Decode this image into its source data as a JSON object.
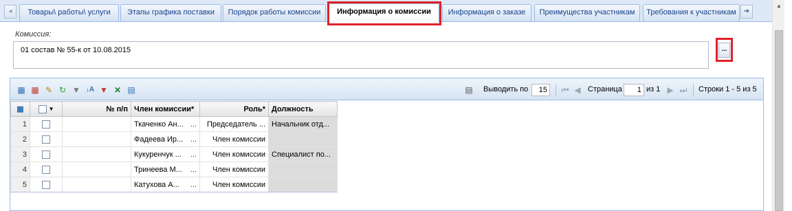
{
  "tabs": {
    "scroll_left": "◂",
    "scroll_right": "➔",
    "items": [
      {
        "label": "Товары\\ работы\\ услуги"
      },
      {
        "label": "Этапы графика поставки"
      },
      {
        "label": "Порядок работы комиссии"
      },
      {
        "label": "Информация о комиссии"
      },
      {
        "label": "Информация о заказе"
      },
      {
        "label": "Преимущества участникам"
      },
      {
        "label": "Требования к участникам"
      }
    ]
  },
  "commission": {
    "label": "Комиссия:",
    "value": "01 состав № 55-к от 10.08.2015",
    "browse_label": "..."
  },
  "toolbar": {
    "page_size_label": "Выводить по",
    "page_size": "15",
    "page_label": "Страница",
    "page": "1",
    "page_of": "из 1",
    "rows_info": "Строки 1 - 5 из 5"
  },
  "grid": {
    "columns": [
      "№ п/п",
      "Член комиссии*",
      "Роль*",
      "Должность"
    ],
    "rows": [
      {
        "n": "1",
        "member": "Ткаченко Ан...",
        "role": "Председатель ...",
        "position": "Начальник отд..."
      },
      {
        "n": "2",
        "member": "Фадеева Ир...",
        "role": "Член комиссии",
        "position": ""
      },
      {
        "n": "3",
        "member": "Кукуренчук ...",
        "role": "Член комиссии",
        "position": "Специалист по..."
      },
      {
        "n": "4",
        "member": "Тринеева М...",
        "role": "Член комиссии",
        "position": ""
      },
      {
        "n": "5",
        "member": "Катухова А...",
        "role": "Член комиссии",
        "position": ""
      }
    ],
    "cell_dots": "..."
  },
  "colors": {
    "highlight": "#e0202a",
    "tab_text": "#15428b",
    "border": "#99bbe8"
  }
}
